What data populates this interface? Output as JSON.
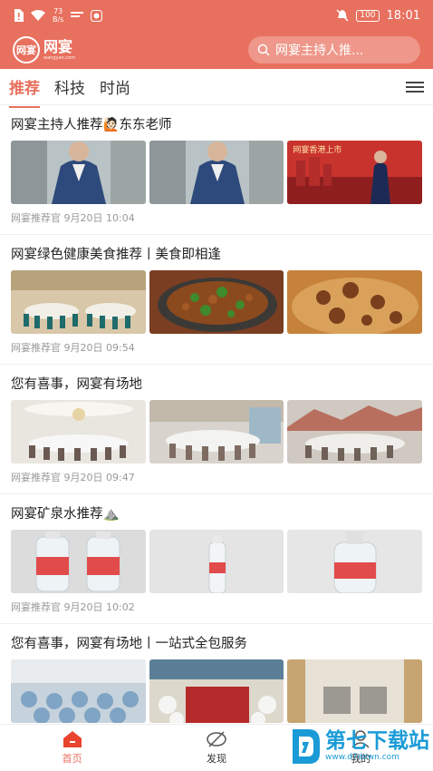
{
  "status": {
    "net_speed_value": "73",
    "net_speed_unit": "B/s",
    "battery": "100",
    "time": "18:01"
  },
  "header": {
    "logo_badge": "网宴",
    "logo_name": "网宴",
    "logo_sub": "wangyan.com",
    "search_placeholder": "网宴主持人推..."
  },
  "tabs": [
    {
      "label": "推荐"
    },
    {
      "label": "科技"
    },
    {
      "label": "时尚"
    }
  ],
  "articles": [
    {
      "title": "网宴主持人推荐🙋🏻东东老师",
      "meta": "网宴推荐官 9月20日 10:04"
    },
    {
      "title": "网宴绿色健康美食推荐丨美食即相逢",
      "meta": "网宴推荐官 9月20日 09:54"
    },
    {
      "title": "您有喜事，网宴有场地",
      "meta": "网宴推荐官 9月20日 09:47"
    },
    {
      "title": "网宴矿泉水推荐⛰️",
      "meta": "网宴推荐官 9月20日 10:02"
    },
    {
      "title": "您有喜事，网宴有场地丨一站式全包服务",
      "meta": ""
    }
  ],
  "thumb_texts": {
    "poster_banner": "网宴香港上市"
  },
  "bottom_nav": [
    {
      "label": "首页"
    },
    {
      "label": "发现"
    },
    {
      "label": "我的"
    }
  ],
  "watermark": {
    "title": "第七下载站",
    "url": "www.d7down.com"
  }
}
